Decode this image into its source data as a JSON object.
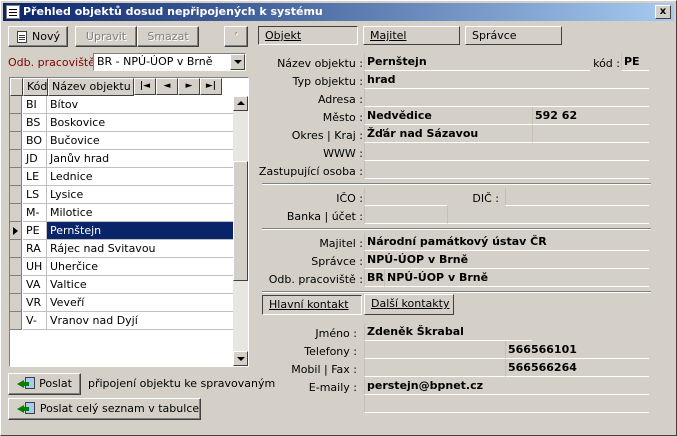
{
  "window": {
    "title": "Přehled objektů dosud nepřipojených k systému",
    "close": "x"
  },
  "toolbar": {
    "new": "Nový",
    "edit": "Upravit",
    "delete": "Smazat",
    "extra": "’"
  },
  "filter": {
    "label": "Odb. pracoviště :",
    "value": "BR - NPÚ-ÚOP v Brně"
  },
  "list": {
    "headers": {
      "code": "Kód",
      "name": "Název objektu"
    },
    "nav": [
      "|◄",
      "◄",
      "►",
      "►|"
    ],
    "rows": [
      {
        "code": "BI",
        "name": "Bítov"
      },
      {
        "code": "BS",
        "name": "Boskovice"
      },
      {
        "code": "BO",
        "name": "Bučovice"
      },
      {
        "code": "JD",
        "name": "Janův hrad"
      },
      {
        "code": "LE",
        "name": "Lednice"
      },
      {
        "code": "LS",
        "name": "Lysice"
      },
      {
        "code": "M-",
        "name": "Milotice"
      },
      {
        "code": "PE",
        "name": "Pernštejn"
      },
      {
        "code": "RA",
        "name": "Rájec nad Svitavou"
      },
      {
        "code": "UH",
        "name": "Uherčice"
      },
      {
        "code": "VA",
        "name": "Valtice"
      },
      {
        "code": "VR",
        "name": "Veveří"
      },
      {
        "code": "V-",
        "name": "Vranov nad Dyjí"
      }
    ],
    "selected_index": 7
  },
  "send": {
    "button": "Poslat",
    "desc": "připojení objektu ke spravovaným",
    "all_button": "Poslat celý seznam v tabulce"
  },
  "tabs": {
    "object": "Objekt",
    "owner": "Majitel",
    "manager": "Správce"
  },
  "form": {
    "name_label": "Název objektu :",
    "name": "Pernštejn",
    "code_label": "kód :",
    "code": "PE",
    "type_label": "Typ objektu :",
    "type": "hrad",
    "address_label": "Adresa :",
    "address": "",
    "city_label": "Město :",
    "city": "Nedvědice",
    "zip": "592 62",
    "district_label": "Okres | Kraj :",
    "district": "Žďár nad Sázavou",
    "region": "",
    "www_label": "WWW :",
    "www": "",
    "rep_label": "Zastupující osoba :",
    "rep": "",
    "ico_label": "IČO :",
    "ico": "",
    "dic_label": "DIČ :",
    "dic": "",
    "bank_label": "Banka | účet :",
    "bank": "",
    "account": "",
    "owner_label": "Majitel :",
    "owner": "Národní památkový ústav ČR",
    "manager_label": "Správce :",
    "manager": "NPÚ-ÚOP v Brně",
    "dept_label": "Odb. pracoviště :",
    "dept_code": "BR",
    "dept": "NPÚ-ÚOP v Brně"
  },
  "contact_tabs": {
    "main": "Hlavní kontakt",
    "other": "Další kontakty"
  },
  "contact": {
    "name_label": "Jméno :",
    "name": "Zdeněk Škrabal",
    "phone_label": "Telefony :",
    "phone": "566566101",
    "mobile_label": "Mobil | Fax :",
    "fax": "566566264",
    "email_label": "E-maily :",
    "email": "perstejn@bpnet.cz"
  }
}
